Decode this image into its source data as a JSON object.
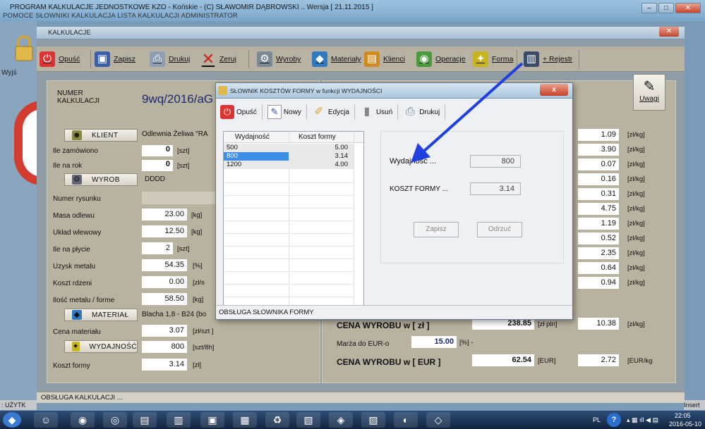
{
  "app": {
    "title": "PROGRAM KALKULACJE JEDNOSTKOWE KZO - Końskie - (C) SŁAWOMIR DĄBROWSKI .. Wersja [ 21.11.2015 ]",
    "menu": "POMOCE   SŁOWNIKI   KALKULACJA   LISTA KALKULACJI   ADMINISTRATOR",
    "exit_label": "Wyjś"
  },
  "kalk_window": {
    "title": "KALKULACJE",
    "status": "OBSŁUGA KALKULACJI ..."
  },
  "toolbar": {
    "opusc": "Opuść",
    "zapisz": "Zapisz",
    "drukuj": "Drukuj",
    "zeruj": "Zeruj",
    "wyroby": "Wyroby",
    "materialy": "Materiały",
    "klienci": "Klienci",
    "operacje": "Operacje",
    "forma": "Forma",
    "rejestr": "+ Rejestr"
  },
  "kalk": {
    "numer_label": "NUMER\nKALKULACJI",
    "numer_value": "9wq/2016/aG",
    "uwagi": "Uwagi"
  },
  "left": {
    "klient_btn": "KLIENT",
    "klient_value": "Odlewnia Żeliwa \"RA",
    "ile_zamowiono": {
      "label": "Ile zamówiono",
      "value": "0",
      "unit": "[szt]"
    },
    "ile_na_rok": {
      "label": "Ile na rok",
      "value": "0",
      "unit": "[szt]"
    },
    "wyrob_btn": "WYROB",
    "wyrob_value": "DDDD",
    "numer_rysunku": "Numer rysunku",
    "masa": {
      "label": "Masa odlewu",
      "value": "23.00",
      "unit": "[kg]"
    },
    "uklad": {
      "label": "Układ wlewowy",
      "value": "12.50",
      "unit": "[kg]"
    },
    "ile_plycie": {
      "label": "Ile na płycie",
      "value": "2",
      "unit": "[szt]"
    },
    "uzysk": {
      "label": "Uzysk metalu",
      "value": "54.35",
      "unit": "[%]"
    },
    "koszt_rdzeni": {
      "label": "Koszt rdzeni",
      "value": "0.00",
      "unit": "[zł/s"
    },
    "ilosc_metalu": {
      "label": "Ilość metalu / forme",
      "value": "58.50",
      "unit": "[kg]"
    },
    "material_btn": "MATERIAŁ",
    "material_value": "Blacha 1,8 - B24 (bo",
    "cena_mat": {
      "label": "Cena materiału",
      "value": "3.07",
      "unit": "[zł/szt ]"
    },
    "wydajnosc_btn": "WYDAJNOŚĆ",
    "wydajnosc": {
      "value": "800",
      "unit": "[szt/8h]"
    },
    "koszt_formy": {
      "label": "Koszt formy",
      "value": "3.14",
      "unit": "[zł]"
    }
  },
  "right": {
    "rows": [
      {
        "v": "1.09",
        "u": "[zł/kg]"
      },
      {
        "v": "3.90",
        "u": "[zł/kg]"
      },
      {
        "v": "0.07",
        "u": "[zł/kg]"
      },
      {
        "v": "0.16",
        "u": "[zł/kg]"
      },
      {
        "v": "0.31",
        "u": "[zł/kg]"
      },
      {
        "v": "4.75",
        "u": "[zł/kg]"
      },
      {
        "v": "1.19",
        "u": "[zł/kg]"
      },
      {
        "v": "0.52",
        "u": "[zł/kg]"
      },
      {
        "v": "2.35",
        "u": "[zł/kg]"
      },
      {
        "v": "0.64",
        "u": "[zł/kg]"
      },
      {
        "v": "0.94",
        "u": "[zł/kg]"
      }
    ],
    "cena_wyrobu_zl_label": "CENA WYROBU w [ zł ]",
    "cena_wyrobu_zl": "238.85",
    "cena_wyrobu_zl_unit": "[zł pln]",
    "cena_kg": "10.38",
    "cena_kg_unit": "[zł/kg]",
    "marza_label": "Marża do EUR-o",
    "marza_value": "15.00",
    "marza_unit": "[%] -",
    "cena_eur_label": "CENA WYROBU w [ EUR ]",
    "cena_eur": "62.54",
    "cena_eur_unit": "[EUR]",
    "eur_kg": "2.72",
    "eur_kg_unit": "[EUR/kg"
  },
  "dialog": {
    "title": "SŁOWNIK KOSZTÓW FORMY w funkcji WYDAJNOŚCI",
    "tb": {
      "opusc": "Opuść",
      "nowy": "Nowy",
      "edycja": "Edycja",
      "usun": "Usuń",
      "drukuj": "Drukuj"
    },
    "grid": {
      "headers": [
        "Wydajność",
        "Koszt formy"
      ],
      "rows": [
        [
          "500",
          "5.00"
        ],
        [
          "800",
          "3.14"
        ],
        [
          "1200",
          "4.00"
        ]
      ]
    },
    "wyd_label": "Wydajność ...",
    "wyd_value": "800",
    "koszt_label": "KOSZT FORMY ...",
    "koszt_value": "3.14",
    "zapisz": "Zapisz",
    "odrzuc": "Odrzuć",
    "status": "OBSŁUGA  SŁOWNIKA  FORMY"
  },
  "status": {
    "uzytk": ": UŻYTK",
    "insert": "Insert"
  },
  "tray": {
    "lang": "PL",
    "time": "22:05",
    "date": "2016-05-10"
  },
  "colors": {
    "arrow": "#1f3fe0",
    "selected_row": "#3d8ee6"
  }
}
